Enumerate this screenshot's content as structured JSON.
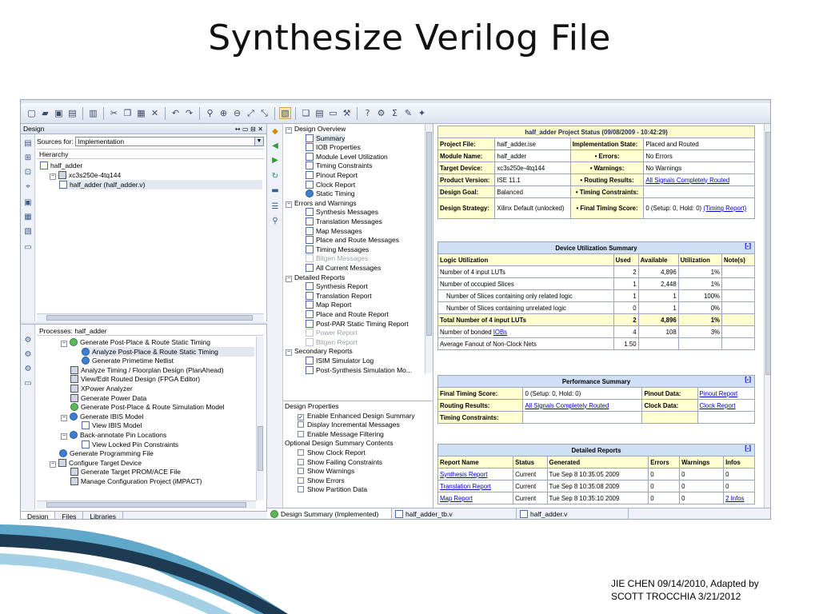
{
  "slide": {
    "title": "Synthesize Verilog File",
    "credit_line1": "JIE CHEN 09/14/2010, Adapted by",
    "credit_line2": "SCOTT TROCCHIA 3/21/2012"
  },
  "toolbar_icons": [
    "new-file-icon",
    "open-icon",
    "save-icon",
    "save-all-icon",
    "print-icon",
    "cut-icon",
    "copy-icon",
    "paste-icon",
    "delete-icon",
    "undo-icon",
    "redo-icon",
    "find-icon",
    "zoom-in-icon",
    "zoom-out-icon",
    "zoom-fit-icon",
    "zoom-full-icon",
    "design-summary-icon",
    "cascade-icon",
    "tile-icon",
    "window-icon",
    "properties-icon",
    "help-icon",
    "implement-icon",
    "sigma-icon",
    "tools-icon",
    "bulb-icon"
  ],
  "design_panel": {
    "title": "Design",
    "controls": "↔ ▭ ⊟ ✕",
    "sources_label": "Sources for:",
    "sources_value": "Implementation",
    "hierarchy_label": "Hierarchy",
    "hierarchy": [
      {
        "label": "half_adder",
        "indent": 0,
        "icon": "project-icon"
      },
      {
        "label": "xc3s250e-4tq144",
        "indent": 1,
        "icon": "chip-icon",
        "expander": "⊟"
      },
      {
        "label": "half_adder (half_adder.v)",
        "indent": 2,
        "icon": "verilog-module-icon",
        "selected": true
      }
    ],
    "processes_label": "Processes: half_adder",
    "processes": [
      {
        "label": "Generate Post-Place & Route Static Timing",
        "indent": 2,
        "expander": "⊟",
        "icon": "process-ok-icon"
      },
      {
        "label": "Analyze Post-Place & Route Static Timing",
        "indent": 3,
        "icon": "analyze-icon",
        "selected": true
      },
      {
        "label": "Generate Primetime Netlist",
        "indent": 3,
        "icon": "process-icon"
      },
      {
        "label": "Analyze Timing / Floorplan Design (PlanAhead)",
        "indent": 2,
        "icon": "planahead-icon"
      },
      {
        "label": "View/Edit Routed Design (FPGA Editor)",
        "indent": 2,
        "icon": "fpga-editor-icon"
      },
      {
        "label": "XPower Analyzer",
        "indent": 2,
        "icon": "xpower-icon"
      },
      {
        "label": "Generate Power Data",
        "indent": 2,
        "icon": "power-data-icon"
      },
      {
        "label": "Generate Post-Place & Route Simulation Model",
        "indent": 2,
        "icon": "process-ok-icon"
      },
      {
        "label": "Generate IBIS Model",
        "indent": 2,
        "expander": "⊟",
        "icon": "process-icon"
      },
      {
        "label": "View IBIS Model",
        "indent": 3,
        "icon": "report-icon"
      },
      {
        "label": "Back-annotate Pin Locations",
        "indent": 2,
        "expander": "⊟",
        "icon": "process-icon"
      },
      {
        "label": "View Locked Pin Constraints",
        "indent": 3,
        "icon": "report-icon"
      },
      {
        "label": "Generate Programming File",
        "indent": 1,
        "icon": "process-icon"
      },
      {
        "label": "Configure Target Device",
        "indent": 1,
        "expander": "⊟",
        "icon": "configure-icon"
      },
      {
        "label": "Generate Target PROM/ACE File",
        "indent": 2,
        "icon": "prom-icon"
      },
      {
        "label": "Manage Configuration Project (iMPACT)",
        "indent": 2,
        "icon": "impact-icon"
      }
    ],
    "tabs": [
      "Design",
      "Files",
      "Libraries"
    ]
  },
  "summary_tree": {
    "items": [
      {
        "label": "Design Overview",
        "level": 0,
        "expander": "⊟"
      },
      {
        "label": "Summary",
        "level": 1,
        "selected": true
      },
      {
        "label": "IOB Properties",
        "level": 1
      },
      {
        "label": "Module Level Utilization",
        "level": 1
      },
      {
        "label": "Timing Constraints",
        "level": 1
      },
      {
        "label": "Pinout Report",
        "level": 1
      },
      {
        "label": "Clock Report",
        "level": 1
      },
      {
        "label": "Static Timing",
        "level": 1,
        "icon": "timing"
      },
      {
        "label": "Errors and Warnings",
        "level": 0,
        "expander": "⊟"
      },
      {
        "label": "Synthesis Messages",
        "level": 1
      },
      {
        "label": "Translation Messages",
        "level": 1
      },
      {
        "label": "Map Messages",
        "level": 1
      },
      {
        "label": "Place and Route Messages",
        "level": 1
      },
      {
        "label": "Timing Messages",
        "level": 1
      },
      {
        "label": "Bitgen Messages",
        "level": 1,
        "muted": true
      },
      {
        "label": "All Current Messages",
        "level": 1
      },
      {
        "label": "Detailed Reports",
        "level": 0,
        "expander": "⊟"
      },
      {
        "label": "Synthesis Report",
        "level": 1
      },
      {
        "label": "Translation Report",
        "level": 1
      },
      {
        "label": "Map Report",
        "level": 1
      },
      {
        "label": "Place and Route Report",
        "level": 1
      },
      {
        "label": "Post-PAR Static Timing Report",
        "level": 1
      },
      {
        "label": "Power Report",
        "level": 1,
        "muted": true
      },
      {
        "label": "Bitgen Report",
        "level": 1,
        "muted": true
      },
      {
        "label": "Secondary Reports",
        "level": 0,
        "expander": "⊟"
      },
      {
        "label": "ISIM Simulator Log",
        "level": 1
      },
      {
        "label": "Post-Synthesis Simulation Mo...",
        "level": 1
      }
    ],
    "props_title": "Design Properties",
    "props": [
      {
        "label": "Enable Enhanced Design Summary",
        "checked": true,
        "level": 1
      },
      {
        "label": "Display Incremental Messages",
        "checked": false,
        "level": 1
      },
      {
        "label": "Enable Message Filtering",
        "checked": false,
        "level": 1
      }
    ],
    "optional_title": "Optional Design Summary Contents",
    "optional": [
      {
        "label": "Show Clock Report",
        "checked": false
      },
      {
        "label": "Show Failing Constraints",
        "checked": false
      },
      {
        "label": "Show Warnings",
        "checked": false
      },
      {
        "label": "Show Errors",
        "checked": false
      },
      {
        "label": "Show Partition Data",
        "checked": false
      }
    ]
  },
  "project_status": {
    "title": "half_adder Project Status (09/08/2009 - 10:42:29)",
    "rows": [
      [
        "Project File:",
        "half_adder.ise",
        "Implementation State:",
        "Placed and Routed"
      ],
      [
        "Module Name:",
        "half_adder",
        "• Errors:",
        "No Errors"
      ],
      [
        "Target Device:",
        "xc3s250e-4tq144",
        "• Warnings:",
        "No Warnings"
      ],
      [
        "Product Version:",
        "ISE 11.1",
        "• Routing Results:",
        "All Signals Completely Routed"
      ],
      [
        "Design Goal:",
        "Balanced",
        "• Timing Constraints:",
        ""
      ],
      [
        "Design Strategy:",
        "Xilinx Default (unlocked)",
        "• Final Timing Score:",
        "0 (Setup: 0, Hold: 0)"
      ]
    ],
    "timing_report_link": "(Timing Report)"
  },
  "device_util": {
    "title": "Device Utilization Summary",
    "collapse": "[-]",
    "headers": [
      "Logic Utilization",
      "Used",
      "Available",
      "Utilization",
      "Note(s)"
    ],
    "rows": [
      {
        "cells": [
          "Number of 4 input LUTs",
          "2",
          "4,896",
          "1%",
          ""
        ]
      },
      {
        "cells": [
          "Number of occupied Slices",
          "1",
          "2,448",
          "1%",
          ""
        ]
      },
      {
        "cells": [
          "Number of Slices containing only related logic",
          "1",
          "1",
          "100%",
          ""
        ],
        "indent": true
      },
      {
        "cells": [
          "Number of Slices containing unrelated logic",
          "0",
          "1",
          "0%",
          ""
        ],
        "indent": true
      },
      {
        "cells": [
          "Total Number of 4 input LUTs",
          "2",
          "4,896",
          "1%",
          ""
        ],
        "bold": true
      },
      {
        "cells": [
          "Number of bonded ",
          "4",
          "108",
          "3%",
          ""
        ],
        "link": "IOBs"
      },
      {
        "cells": [
          "Average Fanout of Non-Clock Nets",
          "1.50",
          "",
          "",
          ""
        ]
      }
    ]
  },
  "performance": {
    "title": "Performance Summary",
    "collapse": "[-]",
    "rows": [
      [
        "Final Timing Score:",
        "0 (Setup: 0, Hold: 0)",
        "Pinout Data:",
        "Pinout Report"
      ],
      [
        "Routing Results:",
        "All Signals Completely Routed",
        "Clock Data:",
        "Clock Report"
      ],
      [
        "Timing Constraints:",
        "",
        "",
        ""
      ]
    ]
  },
  "detailed": {
    "title": "Detailed Reports",
    "collapse": "[-]",
    "headers": [
      "Report Name",
      "Status",
      "Generated",
      "Errors",
      "Warnings",
      "Infos"
    ],
    "rows": [
      [
        "Synthesis Report",
        "Current",
        "Tue Sep 8 10:35:05 2009",
        "0",
        "0",
        "0"
      ],
      [
        "Translation Report",
        "Current",
        "Tue Sep 8 10:35:08 2009",
        "0",
        "0",
        "0"
      ],
      [
        "Map Report",
        "Current",
        "Tue Sep 8 10:35:10 2009",
        "0",
        "0",
        "2 Infos"
      ]
    ]
  },
  "editor_tabs": [
    {
      "label": "Design Summary (Implemented)",
      "active": true
    },
    {
      "label": "half_adder_tb.v",
      "active": false
    },
    {
      "label": "half_adder.v",
      "active": false
    }
  ]
}
